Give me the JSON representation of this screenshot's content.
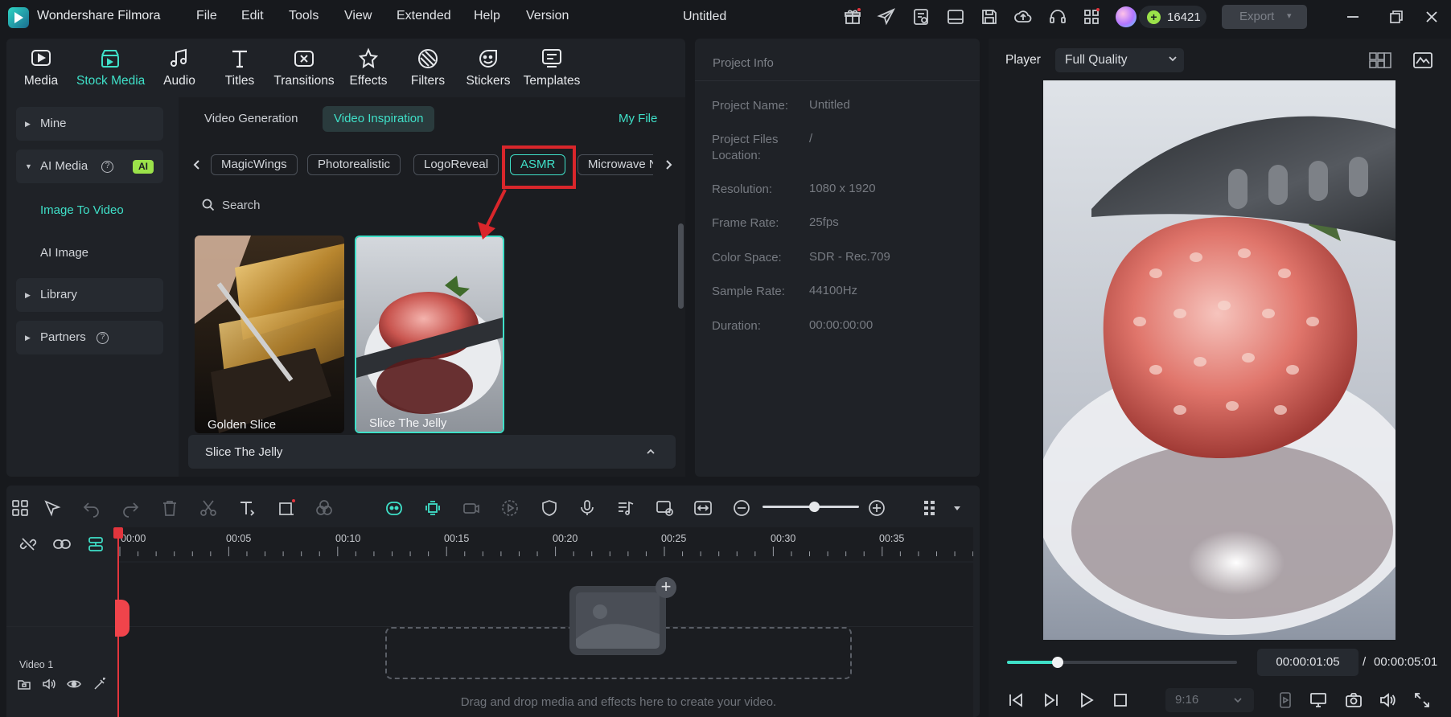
{
  "app": {
    "name": "Wondershare Filmora",
    "doc_title": "Untitled",
    "menu": [
      "File",
      "Edit",
      "Tools",
      "View",
      "Extended",
      "Help",
      "Version"
    ],
    "credits": "16421",
    "export_label": "Export"
  },
  "toolbar_tabs": [
    {
      "label": "Media",
      "icon": "media-icon"
    },
    {
      "label": "Stock Media",
      "icon": "stock-media-icon"
    },
    {
      "label": "Audio",
      "icon": "audio-icon"
    },
    {
      "label": "Titles",
      "icon": "titles-icon"
    },
    {
      "label": "Transitions",
      "icon": "transitions-icon"
    },
    {
      "label": "Effects",
      "icon": "effects-icon"
    },
    {
      "label": "Filters",
      "icon": "filters-icon"
    },
    {
      "label": "Stickers",
      "icon": "stickers-icon"
    },
    {
      "label": "Templates",
      "icon": "templates-icon"
    }
  ],
  "sidebar": {
    "mine": "Mine",
    "ai_media": "AI Media",
    "ai_badge": "AI",
    "image_to_video": "Image To Video",
    "ai_image": "AI Image",
    "library": "Library",
    "partners": "Partners"
  },
  "content": {
    "segments": [
      "Video Generation",
      "Video Inspiration"
    ],
    "my_file": "My File",
    "chips": [
      "MagicWings",
      "Photorealistic",
      "LogoReveal",
      "ASMR",
      "Microwave N"
    ],
    "search_placeholder": "Search",
    "cards": [
      "Golden Slice",
      "Slice The Jelly"
    ],
    "detail_title": "Slice The Jelly"
  },
  "project_info": {
    "title": "Project Info",
    "rows": [
      {
        "label": "Project Name:",
        "value": "Untitled"
      },
      {
        "label": "Project Files Location:",
        "value": "/"
      },
      {
        "label": "Resolution:",
        "value": "1080 x 1920"
      },
      {
        "label": "Frame Rate:",
        "value": "25fps"
      },
      {
        "label": "Color Space:",
        "value": "SDR - Rec.709"
      },
      {
        "label": "Sample Rate:",
        "value": "44100Hz"
      },
      {
        "label": "Duration:",
        "value": "00:00:00:00"
      }
    ]
  },
  "player": {
    "label": "Player",
    "quality": "Full Quality",
    "current_time": "00:00:01:05",
    "separator": "/",
    "total_time": "00:00:05:01",
    "progress_fraction": 0.22,
    "aspect_ratio": "9:16"
  },
  "timeline": {
    "ticks": [
      "00:00",
      "00:05",
      "00:10",
      "00:15",
      "00:20",
      "00:25",
      "00:30",
      "00:35"
    ],
    "track_label": "Video 1",
    "drop_text": "Drag and drop media and effects here to create your video.",
    "zoom_fraction": 0.53
  },
  "colors": {
    "accent": "#3fe0c8",
    "highlight": "#d9262b",
    "playhead": "#e2353d",
    "credit_coin": "#9be24a"
  }
}
